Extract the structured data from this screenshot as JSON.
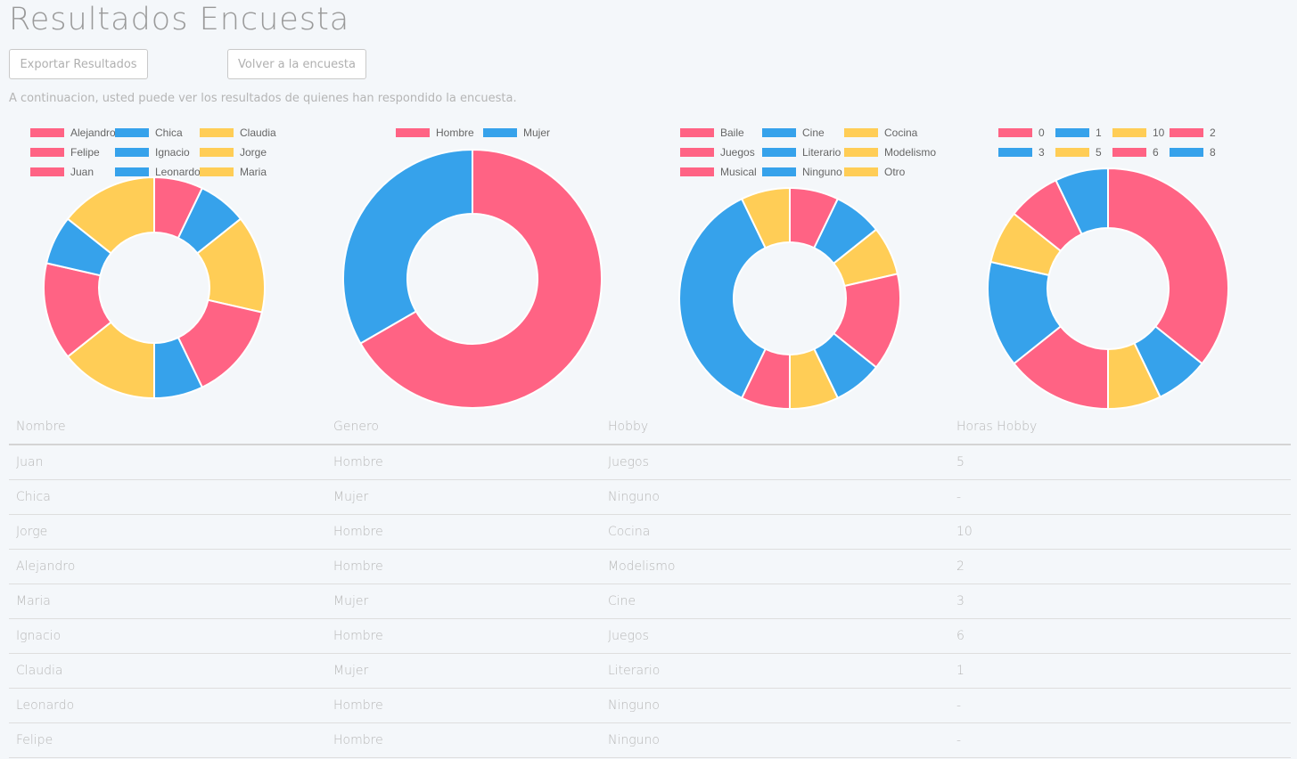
{
  "page": {
    "title": "Resultados Encuesta",
    "export_label": "Exportar Resultados",
    "back_label": "Volver a la encuesta",
    "intro": "A continuacion, usted puede ver los resultados de quienes han respondido la encuesta."
  },
  "colors": {
    "red": "#ff6384",
    "blue": "#36a2eb",
    "yellow": "#ffcd56"
  },
  "chart_data": [
    {
      "type": "pie",
      "categories": [
        "Alejandro",
        "Chica",
        "Claudia",
        "Felipe",
        "Ignacio",
        "Jorge",
        "Juan",
        "Leonardo",
        "Maria"
      ],
      "values": [
        1,
        1,
        2,
        2,
        1,
        2,
        2,
        1,
        2
      ],
      "colors": [
        "#ff6384",
        "#36a2eb",
        "#ffcd56",
        "#ff6384",
        "#36a2eb",
        "#ffcd56",
        "#ff6384",
        "#36a2eb",
        "#ffcd56"
      ],
      "legend": "top"
    },
    {
      "type": "pie",
      "categories": [
        "Hombre",
        "Mujer"
      ],
      "values": [
        6,
        3
      ],
      "colors": [
        "#ff6384",
        "#36a2eb"
      ],
      "legend": "top"
    },
    {
      "type": "pie",
      "categories": [
        "Baile",
        "Cine",
        "Cocina",
        "Juegos",
        "Literario",
        "Modelismo",
        "Musical",
        "Ninguno",
        "Otro"
      ],
      "values": [
        1,
        1,
        1,
        2,
        1,
        1,
        1,
        5,
        1
      ],
      "colors": [
        "#ff6384",
        "#36a2eb",
        "#ffcd56",
        "#ff6384",
        "#36a2eb",
        "#ffcd56",
        "#ff6384",
        "#36a2eb",
        "#ffcd56"
      ],
      "legend": "top"
    },
    {
      "type": "pie",
      "categories": [
        "0",
        "1",
        "10",
        "2",
        "3",
        "5",
        "6",
        "8"
      ],
      "values": [
        5,
        1,
        1,
        2,
        2,
        1,
        1,
        1
      ],
      "colors": [
        "#ff6384",
        "#36a2eb",
        "#ffcd56",
        "#ff6384",
        "#36a2eb",
        "#ffcd56",
        "#ff6384",
        "#36a2eb"
      ],
      "legend": "top"
    }
  ],
  "table": {
    "headers": [
      "Nombre",
      "Genero",
      "Hobby",
      "Horas Hobby"
    ],
    "rows": [
      [
        "Juan",
        "Hombre",
        "Juegos",
        "5"
      ],
      [
        "Chica",
        "Mujer",
        "Ninguno",
        "-"
      ],
      [
        "Jorge",
        "Hombre",
        "Cocina",
        "10"
      ],
      [
        "Alejandro",
        "Hombre",
        "Modelismo",
        "2"
      ],
      [
        "Maria",
        "Mujer",
        "Cine",
        "3"
      ],
      [
        "Ignacio",
        "Hombre",
        "Juegos",
        "6"
      ],
      [
        "Claudia",
        "Mujer",
        "Literario",
        "1"
      ],
      [
        "Leonardo",
        "Hombre",
        "Ninguno",
        "-"
      ],
      [
        "Felipe",
        "Hombre",
        "Ninguno",
        "-"
      ]
    ]
  }
}
